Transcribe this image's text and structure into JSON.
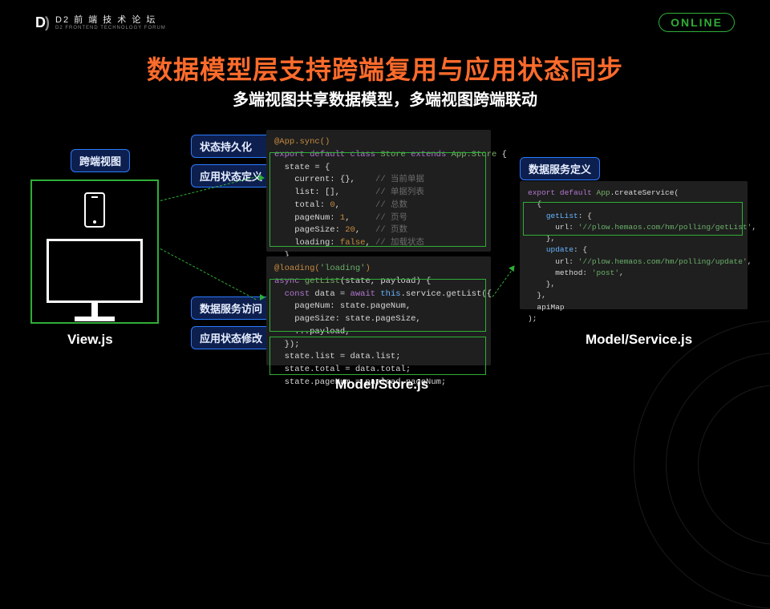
{
  "badge": "ONLINE",
  "logo_main": "D2 前 端 技 术 论 坛",
  "logo_sub": "D2 FRONTEND TECHNOLOGY FORUM",
  "headline": "数据模型层支持跨端复用与应用状态同步",
  "subhead": "多端视图共享数据模型，多端视图跨端联动",
  "left": {
    "tag": "跨端视图",
    "label": "View.js"
  },
  "mid": {
    "tags_top": [
      "状态持久化",
      "应用状态定义"
    ],
    "tags_bot": [
      "数据服务访问",
      "应用状态修改"
    ],
    "label": "Model/Store.js"
  },
  "right": {
    "tag": "数据服务定义",
    "label": "Model/Service.js"
  },
  "store_code": "@App.sync()\nexport default class Store extends App.Store {\n  state = {\n    current: {},    // 当前单据\n    list: [],       // 单据列表\n    total: 0,       // 总数\n    pageNum: 1,     // 页号\n    pageSize: 20,   // 页数\n    loading: false, // 加载状态\n  }",
  "store_code2": "@loading('loading')\nasync getList(state, payload) {\n  const data = await this.service.getList({\n    pageNum: state.pageNum,\n    pageSize: state.pageSize,\n    ...payload,\n  });\n  state.list = data.list;\n  state.total = data.total;\n  state.pageNum = payload.pageNum;",
  "service_code": "export default App.createService(\n  {\n    getList: {\n      url: '//plow.hemaos.com/hm/polling/getList',\n    },\n    update: {\n      url: '//plow.hemaos.com/hm/polling/update',\n      method: 'post',\n    },\n  },\n  apiMap\n);"
}
